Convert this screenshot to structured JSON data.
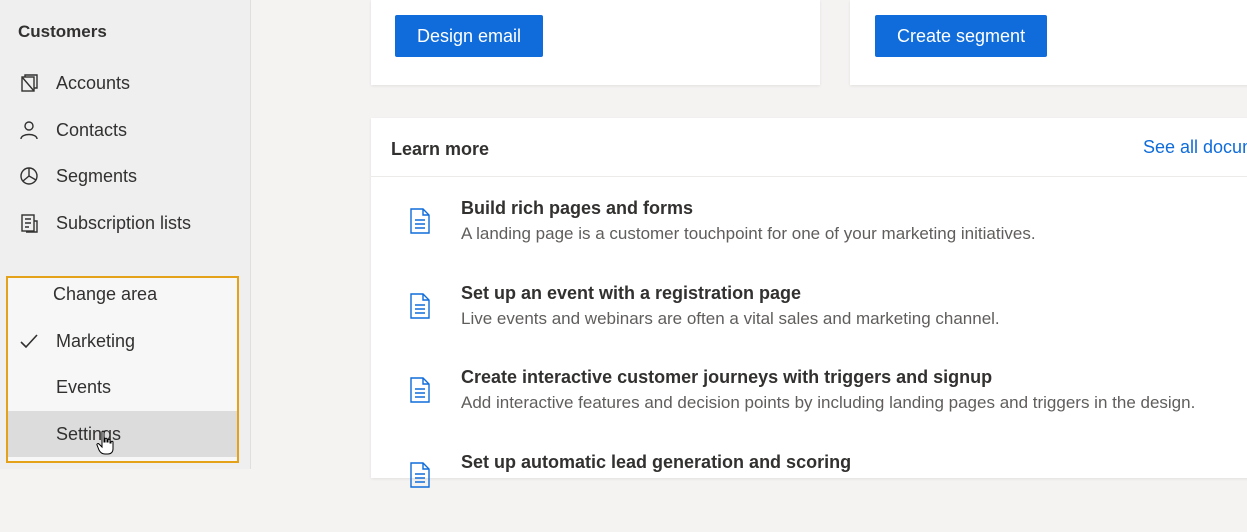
{
  "sidebar": {
    "section_header": "Customers",
    "items": [
      {
        "label": "Accounts",
        "icon": "accounts-icon"
      },
      {
        "label": "Contacts",
        "icon": "person-icon"
      },
      {
        "label": "Segments",
        "icon": "pie-chart-icon"
      },
      {
        "label": "Subscription lists",
        "icon": "subscription-list-icon"
      }
    ]
  },
  "change_area": {
    "title": "Change area",
    "items": [
      {
        "label": "Marketing",
        "checked": true
      },
      {
        "label": "Events",
        "checked": false
      },
      {
        "label": "Settings",
        "checked": false,
        "hovered": true
      }
    ]
  },
  "cards": {
    "design_email_label": "Design email",
    "create_segment_label": "Create segment"
  },
  "learn_more": {
    "header": "Learn more",
    "see_all_label": "See all docum",
    "items": [
      {
        "title": "Build rich pages and forms",
        "desc": "A landing page is a customer touchpoint for one of your marketing initiatives."
      },
      {
        "title": "Set up an event with a registration page",
        "desc": "Live events and webinars are often a vital sales and marketing channel."
      },
      {
        "title": "Create interactive customer journeys with triggers and signup",
        "desc": "Add interactive features and decision points by including landing pages and triggers in the design."
      },
      {
        "title": "Set up automatic lead generation and scoring",
        "desc": ""
      }
    ]
  },
  "colors": {
    "accent": "#0f6cda",
    "highlight_border": "#e3a21a"
  }
}
